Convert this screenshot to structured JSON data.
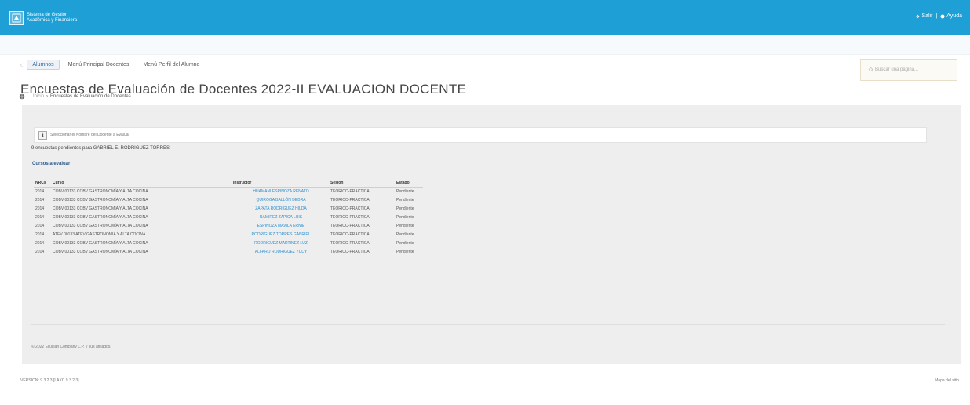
{
  "header": {
    "brand_line1": "Sistema de Gestión",
    "brand_line2": "Académica y Financiera",
    "exit_label": "Salir",
    "help_label": "Ayuda"
  },
  "tabs": [
    {
      "label": "Alumnos"
    },
    {
      "label": "Menú Principal Docentes"
    },
    {
      "label": "Menú Perfil del Alumno"
    }
  ],
  "search": {
    "placeholder": "Buscar una página..."
  },
  "page_title": "Encuestas de Evaluación de Docentes 2022-II EVALUACION DOCENTE",
  "breadcrumb": {
    "home": "Inicio",
    "current": "Encuestas de Evaluación de Docentes"
  },
  "notice": "Seleccionar el Nombre del Docente a Evaluar",
  "pending_text": "9 encuestas pendientes para GABRIEL E. RODRIGUEZ TORRES",
  "section_label": "Cursos a evaluar",
  "table": {
    "headers": [
      "NRCs",
      "Curso",
      "Instructor",
      "Sesión",
      "Estado"
    ],
    "rows": [
      [
        "2014",
        "COBV 00133 COBV GASTRONOMÍA Y ALTA COCINA",
        "HUAMANI ESPINOZA RENATO",
        "TEORICO-PRACTICA",
        "Pendiente"
      ],
      [
        "2014",
        "COBV 00133 COBV GASTRONOMÍA Y ALTA COCINA",
        "QUIROGA BALLÓN DEBRA",
        "TEORICO-PRACTICA",
        "Pendiente"
      ],
      [
        "2014",
        "COBV 00133 COBV GASTRONOMÍA Y ALTA COCINA",
        "ZAPATA RODRIGUEZ HILDA",
        "TEORICO-PRACTICA",
        "Pendiente"
      ],
      [
        "2014",
        "COBV 00133 COBV GASTRONOMÍA Y ALTA COCINA",
        "RAMIREZ ZAPICA LUIS",
        "TEORICO-PRACTICA",
        "Pendiente"
      ],
      [
        "2014",
        "COBV 00133 COBV GASTRONOMÍA Y ALTA COCINA",
        "ESPINOZA MAVILA ERNIE",
        "TEORICO-PRACTICA",
        "Pendiente"
      ],
      [
        "2014",
        "ATEV 00133 ATEV GASTRONOMÍA Y ALTA COCINA",
        "RODRIGUEZ TORRES GABRIEL",
        "TEORICO-PRACTICA",
        "Pendiente"
      ],
      [
        "2014",
        "COBV 00133 COBV GASTRONOMÍA Y ALTA COCINA",
        "RODRIGUEZ MARTINEZ LUZ",
        "TEORICO-PRACTICA",
        "Pendiente"
      ],
      [
        "2014",
        "COBV 00133 COBV GASTRONOMÍA Y ALTA COCINA",
        "ALFARO RODRIGUEZ YUDY",
        "TEORICO-PRACTICA",
        "Pendiente"
      ]
    ]
  },
  "footer": {
    "copyright": "© 2022 Ellucian Company L.P. y sus afiliados.",
    "version": "VERSION: 9.3.2.3 [LAXC 9.3.2.3]",
    "site_map": "Mapa del sitio"
  },
  "colors": {
    "topbar": "#1e9fd6",
    "link": "#2a8fd0",
    "panel": "#eeeeee"
  }
}
